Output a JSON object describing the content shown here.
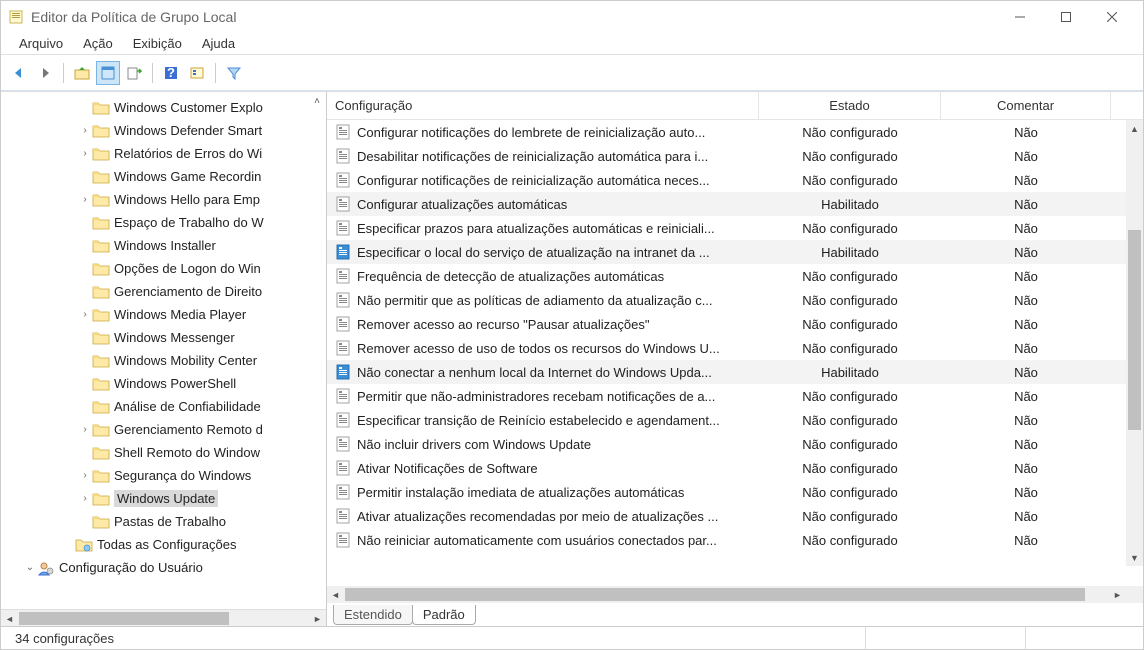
{
  "window": {
    "title": "Editor da Política de Grupo Local"
  },
  "menubar": {
    "items": [
      "Arquivo",
      "Ação",
      "Exibição",
      "Ajuda"
    ]
  },
  "toolbar_icons": [
    "back",
    "forward",
    "up-folder",
    "properties",
    "export",
    "help",
    "show-gpo",
    "filter"
  ],
  "tree": {
    "caret": "^",
    "items": [
      {
        "label": "Windows Customer Explo",
        "expander": "",
        "lvl": ""
      },
      {
        "label": "Windows Defender Smart",
        "expander": ">",
        "lvl": ""
      },
      {
        "label": "Relatórios de Erros do Wi",
        "expander": ">",
        "lvl": ""
      },
      {
        "label": "Windows Game Recordin",
        "expander": "",
        "lvl": ""
      },
      {
        "label": "Windows Hello para Emp",
        "expander": ">",
        "lvl": ""
      },
      {
        "label": "Espaço de Trabalho do W",
        "expander": "",
        "lvl": ""
      },
      {
        "label": "Windows Installer",
        "expander": "",
        "lvl": ""
      },
      {
        "label": "Opções de Logon do Win",
        "expander": "",
        "lvl": ""
      },
      {
        "label": "Gerenciamento de Direito",
        "expander": "",
        "lvl": ""
      },
      {
        "label": "Windows Media Player",
        "expander": ">",
        "lvl": ""
      },
      {
        "label": "Windows Messenger",
        "expander": "",
        "lvl": ""
      },
      {
        "label": "Windows Mobility Center",
        "expander": "",
        "lvl": ""
      },
      {
        "label": "Windows PowerShell",
        "expander": "",
        "lvl": ""
      },
      {
        "label": "Análise de Confiabilidade",
        "expander": "",
        "lvl": ""
      },
      {
        "label": "Gerenciamento Remoto d",
        "expander": ">",
        "lvl": ""
      },
      {
        "label": "Shell Remoto do Window",
        "expander": "",
        "lvl": ""
      },
      {
        "label": "Segurança do Windows",
        "expander": ">",
        "lvl": ""
      },
      {
        "label": "Windows Update",
        "expander": ">",
        "lvl": "",
        "selected": true
      },
      {
        "label": "Pastas de Trabalho",
        "expander": "",
        "lvl": ""
      },
      {
        "label": "Todas as Configurações",
        "expander": "",
        "lvl": "lvl2b",
        "icon": "all-settings"
      },
      {
        "label": "Configuração do Usuário",
        "expander": "v",
        "lvl": "lvl1",
        "icon": "user-config"
      }
    ]
  },
  "list": {
    "columns": {
      "config": "Configuração",
      "state": "Estado",
      "comment": "Comentar"
    },
    "rows": [
      {
        "name": "Configurar notificações do lembrete de reinicialização auto...",
        "state": "Não configurado",
        "comment": "Não"
      },
      {
        "name": "Desabilitar notificações de reinicialização automática para i...",
        "state": "Não configurado",
        "comment": "Não"
      },
      {
        "name": "Configurar notificações de reinicialização automática neces...",
        "state": "Não configurado",
        "comment": "Não"
      },
      {
        "name": "Configurar atualizações automáticas",
        "state": "Habilitado",
        "comment": "Não",
        "hl": true
      },
      {
        "name": "Especificar prazos para atualizações automáticas e reiniciali...",
        "state": "Não configurado",
        "comment": "Não"
      },
      {
        "name": "Especificar o local do serviço de atualização na intranet da ...",
        "state": "Habilitado",
        "comment": "Não",
        "hl": true,
        "enabled": true
      },
      {
        "name": "Frequência de detecção de atualizações automáticas",
        "state": "Não configurado",
        "comment": "Não"
      },
      {
        "name": "Não permitir que as políticas de adiamento da atualização c...",
        "state": "Não configurado",
        "comment": "Não"
      },
      {
        "name": "Remover acesso ao recurso \"Pausar atualizações\"",
        "state": "Não configurado",
        "comment": "Não"
      },
      {
        "name": "Remover acesso de uso de todos os recursos do Windows U...",
        "state": "Não configurado",
        "comment": "Não"
      },
      {
        "name": "Não conectar a nenhum local da Internet do Windows Upda...",
        "state": "Habilitado",
        "comment": "Não",
        "hl": true,
        "enabled": true
      },
      {
        "name": "Permitir que não-administradores recebam notificações de a...",
        "state": "Não configurado",
        "comment": "Não"
      },
      {
        "name": "Especificar transição de Reinício estabelecido e agendament...",
        "state": "Não configurado",
        "comment": "Não"
      },
      {
        "name": "Não incluir drivers com Windows Update",
        "state": "Não configurado",
        "comment": "Não"
      },
      {
        "name": "Ativar Notificações de Software",
        "state": "Não configurado",
        "comment": "Não"
      },
      {
        "name": "Permitir instalação imediata de atualizações automáticas",
        "state": "Não configurado",
        "comment": "Não"
      },
      {
        "name": "Ativar atualizações recomendadas por meio de atualizações ...",
        "state": "Não configurado",
        "comment": "Não"
      },
      {
        "name": "Não reiniciar automaticamente com usuários conectados par...",
        "state": "Não configurado",
        "comment": "Não"
      }
    ]
  },
  "tabs": {
    "extended": "Estendido",
    "standard": "Padrão"
  },
  "statusbar": {
    "text": "34 configurações"
  }
}
